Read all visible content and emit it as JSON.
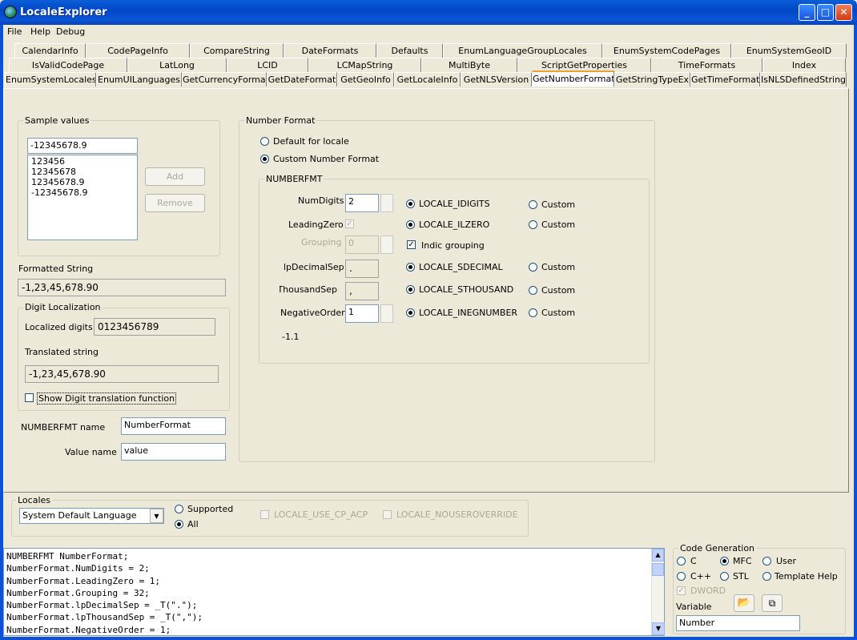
{
  "window": {
    "title": "LocaleExplorer",
    "minimize": "_",
    "maximize": "□",
    "close": "✕"
  },
  "menu": [
    "File",
    "Help",
    "Debug"
  ],
  "tabs": {
    "row1": [
      "CalendarInfo",
      "CodePageInfo",
      "CompareString",
      "DateFormats",
      "Defaults",
      "EnumLanguageGroupLocales",
      "EnumSystemCodePages",
      "EnumSystemGeoID"
    ],
    "row2": [
      "IsValidCodePage",
      "LatLong",
      "LCID",
      "LCMapString",
      "MultiByte",
      "ScriptGetProperties",
      "TimeFormats",
      "Index"
    ],
    "row3": [
      "EnumSystemLocales",
      "EnumUILanguages",
      "GetCurrencyFormat",
      "GetDateFormat",
      "GetGeoInfo",
      "GetLocaleInfo",
      "GetNLSVersion",
      "GetNumberFormat",
      "GetStringTypeEx",
      "GetTimeFormat",
      "IsNLSDefinedString"
    ],
    "active": "GetNumberFormat"
  },
  "sample": {
    "group_label": "Sample values",
    "input_value": "-12345678.9",
    "list": [
      "123456",
      "12345678",
      "12345678.9",
      "-12345678.9"
    ],
    "add_label": "Add",
    "remove_label": "Remove"
  },
  "formatted": {
    "label": "Formatted String",
    "value": "-1,23,45,678.90"
  },
  "digit_loc": {
    "group_label": "Digit Localization",
    "localized_label": "Localized digits",
    "localized_value": "0123456789",
    "translated_label": "Translated string",
    "translated_value": "-1,23,45,678.90",
    "show_fn_label": "Show Digit translation function"
  },
  "names": {
    "numberfmt_label": "NUMBERFMT name",
    "numberfmt_value": "NumberFormat",
    "value_label": "Value name",
    "value_value": "value"
  },
  "number_format": {
    "group_label": "Number Format",
    "default_label": "Default for locale",
    "custom_label": "Custom Number Format",
    "numberfmt_group": "NUMBERFMT",
    "rows": [
      {
        "label": "NumDigits",
        "value": "2",
        "locale": "LOCALE_IDIGITS",
        "custom": "Custom"
      },
      {
        "label": "LeadingZero",
        "value": "",
        "locale": "LOCALE_ILZERO",
        "custom": "Custom"
      },
      {
        "label": "Grouping",
        "value": "0",
        "locale": "Indic grouping",
        "custom": ""
      },
      {
        "label": "lpDecimalSep",
        "value": ".",
        "locale": "LOCALE_SDECIMAL",
        "custom": "Custom"
      },
      {
        "label": "ThousandSep",
        "value": ",",
        "locale": "LOCALE_STHOUSAND",
        "custom": "Custom"
      },
      {
        "label": "NegativeOrder",
        "value": "1",
        "locale": "LOCALE_INEGNUMBER",
        "custom": "Custom"
      }
    ],
    "preview": "-1.1"
  },
  "locales": {
    "group_label": "Locales",
    "selected": "System Default Language",
    "supported_label": "Supported",
    "all_label": "All",
    "use_cp_acp": "LOCALE_USE_CP_ACP",
    "nouseroverride": "LOCALE_NOUSEROVERRIDE"
  },
  "code": [
    "NUMBERFMT NumberFormat;",
    "NumberFormat.NumDigits = 2;",
    "NumberFormat.LeadingZero = 1;",
    "NumberFormat.Grouping = 32;",
    "NumberFormat.lpDecimalSep = _T(\".\");",
    "NumberFormat.lpThousandSep = _T(\",\");",
    "NumberFormat.NegativeOrder = 1;"
  ],
  "codegen": {
    "group_label": "Code Generation",
    "c": "C",
    "mfc": "MFC",
    "user": "User",
    "cpp": "C++",
    "stl": "STL",
    "template_help": "Template Help",
    "dword": "DWORD",
    "variable_label": "Variable",
    "variable_value": "Number"
  }
}
